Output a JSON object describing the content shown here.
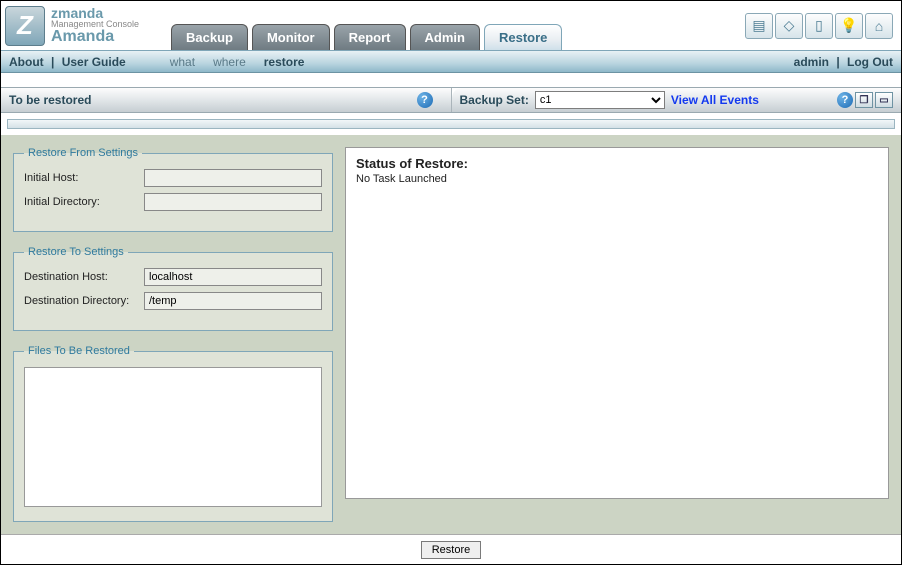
{
  "logo": {
    "line1": "zmanda",
    "line2": "Management Console",
    "line3": "Amanda"
  },
  "tabs": [
    "Backup",
    "Monitor",
    "Report",
    "Admin",
    "Restore"
  ],
  "active_tab": "Restore",
  "subnav_left": {
    "about": "About",
    "userguide": "User Guide"
  },
  "subnav_mid": {
    "what": "what",
    "where": "where",
    "restore": "restore",
    "active": "restore"
  },
  "subnav_right": {
    "admin": "admin",
    "logout": "Log Out"
  },
  "toolbar": {
    "left_title": "To be restored",
    "backup_set_label": "Backup Set:",
    "backup_set_options": [
      "c1"
    ],
    "backup_set_selected": "c1",
    "view_all_events": "View All Events"
  },
  "restore_from": {
    "legend": "Restore From Settings",
    "initial_host_label": "Initial Host:",
    "initial_host_value": "",
    "initial_dir_label": "Initial Directory:",
    "initial_dir_value": ""
  },
  "restore_to": {
    "legend": "Restore To Settings",
    "dest_host_label": "Destination Host:",
    "dest_host_value": "localhost",
    "dest_dir_label": "Destination Directory:",
    "dest_dir_value": "/temp"
  },
  "files": {
    "legend": "Files To Be Restored"
  },
  "status": {
    "title": "Status of Restore:",
    "message": "No Task Launched"
  },
  "bottom": {
    "restore_button": "Restore"
  }
}
